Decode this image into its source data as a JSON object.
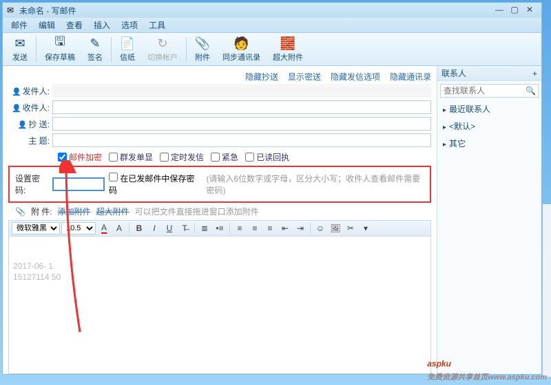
{
  "window": {
    "title": "未命名 - 写邮件"
  },
  "menubar": [
    "邮件",
    "编辑",
    "查看",
    "插入",
    "选项",
    "工具"
  ],
  "toolbar": [
    {
      "label": "发送",
      "icon": "✉"
    },
    {
      "label": "保存草稿",
      "icon": "🖫"
    },
    {
      "label": "签名",
      "icon": "✎"
    },
    {
      "label": "信纸",
      "icon": "📄"
    },
    {
      "label": "切换帐户",
      "icon": "↻",
      "disabled": true
    },
    {
      "label": "附件",
      "icon": "📎"
    },
    {
      "label": "同步通讯录",
      "icon": "🧑"
    },
    {
      "label": "超大附件",
      "icon": "🧱"
    }
  ],
  "links": [
    "隐藏抄送",
    "显示密送",
    "隐藏发信选项",
    "隐藏通讯录"
  ],
  "fields": {
    "from": "发件人:",
    "to": "收件人:",
    "cc": "抄  送:",
    "subject": "主   题:"
  },
  "options": [
    {
      "label": "邮件加密",
      "checked": true
    },
    {
      "label": "群发单显",
      "checked": false
    },
    {
      "label": "定时发信",
      "checked": false
    },
    {
      "label": "紧急",
      "checked": false
    },
    {
      "label": "已读回执",
      "checked": false
    }
  ],
  "password": {
    "label": "设置密码:",
    "save_label": "在已发邮件中保存密码",
    "hint": "(请输入6位数字或字母，区分大小写；收件人查看邮件需要密码)"
  },
  "attach": {
    "label": "附   件:",
    "add": "添加附件",
    "big": "超大附件",
    "tip": "可以把文件直接拖进窗口添加附件"
  },
  "editor_toolbar": {
    "font": "微软雅黑",
    "size": "10.5"
  },
  "editor_body": {
    "date": "2017-06-  1",
    "phone": "15127114  50"
  },
  "contacts": {
    "title": "联系人",
    "search_placeholder": "查找联系人",
    "items": [
      "最近联系人",
      "<默认>",
      "其它"
    ]
  },
  "watermark": {
    "brand": "aspku",
    "sub": "免费资源共享首页www.aspku.com"
  }
}
